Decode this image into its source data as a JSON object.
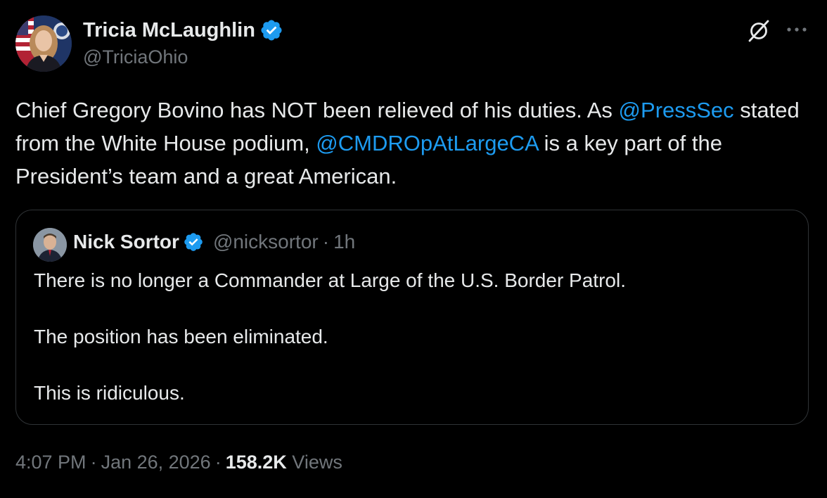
{
  "author": {
    "name": "Tricia McLaughlin",
    "handle": "@TriciaOhio",
    "verified_color": "#1d9bf0",
    "avatar_icon": "avatar-photo"
  },
  "tweet": {
    "segments": [
      {
        "text": "Chief Gregory Bovino has NOT been relieved of his duties. As ",
        "type": "text"
      },
      {
        "text": "@PressSec",
        "type": "mention"
      },
      {
        "text": " stated from the White House podium, ",
        "type": "text"
      },
      {
        "text": "@CMDROpAtLargeCA",
        "type": "mention"
      },
      {
        "text": " is a key part of the President’s team and a great American.",
        "type": "text"
      }
    ]
  },
  "quote": {
    "name": "Nick Sortor",
    "handle": "@nicksortor",
    "separator": "·",
    "time": "1h",
    "lines": [
      "There is no longer a Commander at Large of the U.S. Border Patrol.",
      "The position has been eliminated.",
      "This is ridiculous."
    ]
  },
  "meta": {
    "time": "4:07 PM",
    "separator": "·",
    "date": "Jan 26, 2026",
    "views_count": "158.2K",
    "views_label": "Views"
  },
  "icons": {
    "grok": "grok-icon",
    "more": "more-icon",
    "verified": "verified-badge-icon"
  },
  "colors": {
    "background": "#000000",
    "text": "#e7e9ea",
    "secondary": "#71767b",
    "link": "#1d9bf0",
    "border": "#2f3336"
  }
}
